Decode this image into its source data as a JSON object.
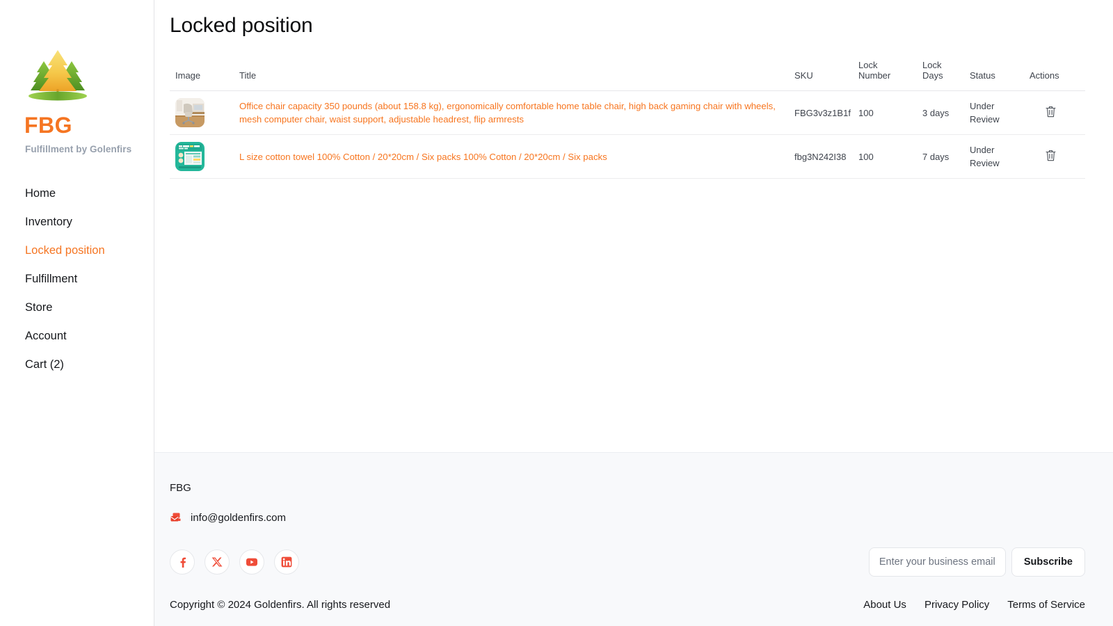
{
  "sidebar": {
    "logo_icon": "fir-tree-logo",
    "brand_name": "FBG",
    "brand_tagline_part1": "Fulfillment",
    "brand_tagline_part2": "by",
    "brand_tagline_part3": "Golenfirs",
    "items": [
      {
        "label": "Home",
        "active": false
      },
      {
        "label": "Inventory",
        "active": false
      },
      {
        "label": "Locked position",
        "active": true
      },
      {
        "label": "Fulfillment",
        "active": false
      },
      {
        "label": "Store",
        "active": false
      },
      {
        "label": "Account",
        "active": false
      },
      {
        "label": "Cart (2)",
        "active": false
      }
    ],
    "accent_color": "#f57522"
  },
  "main": {
    "page_title": "Locked position",
    "table": {
      "columns": [
        "Image",
        "Title",
        "SKU",
        "Lock Number",
        "Lock Days",
        "Status",
        "Actions"
      ],
      "column_headers": {
        "image": "Image",
        "title": "Title",
        "sku": "SKU",
        "lock_number_line1": "Lock",
        "lock_number_line2": "Number",
        "lock_days_line1": "Lock",
        "lock_days_line2": "Days",
        "status": "Status",
        "actions": "Actions"
      },
      "rows": [
        {
          "image_alt": "office-chair-thumbnail",
          "title": "Office chair capacity 350 pounds (about 158.8 kg), ergonomically comfortable home table chair, high back gaming chair with wheels, mesh computer chair, waist support, adjustable headrest, flip armrests",
          "sku": "FBG3v3z1B1f",
          "lock_number": "100",
          "lock_days": "3 days",
          "status": "Under Review",
          "action_icon": "trash-icon"
        },
        {
          "image_alt": "cotton-towel-package-thumbnail",
          "title": "L size cotton towel 100% Cotton / 20*20cm / Six packs 100% Cotton / 20*20cm / Six packs",
          "sku": "fbg3N242I38",
          "lock_number": "100",
          "lock_days": "7 days",
          "status": "Under Review",
          "action_icon": "trash-icon"
        }
      ]
    },
    "title_link_color": "#f7751f"
  },
  "footer": {
    "brand": "FBG",
    "email_icon": "mail-icon",
    "email": "info@goldenfirs.com",
    "socials": [
      {
        "name": "facebook-icon",
        "glyph": "f"
      },
      {
        "name": "x-twitter-icon",
        "glyph": "X"
      },
      {
        "name": "youtube-icon",
        "glyph": "play"
      },
      {
        "name": "linkedin-icon",
        "glyph": "in"
      }
    ],
    "social_color": "#ef4c38",
    "subscribe": {
      "placeholder": "Enter your business email",
      "value": "",
      "button_label": "Subscribe"
    },
    "copyright": "Copyright © 2024 Goldenfirs. All rights reserved",
    "links": [
      "About Us",
      "Privacy Policy",
      "Terms of Service"
    ]
  }
}
